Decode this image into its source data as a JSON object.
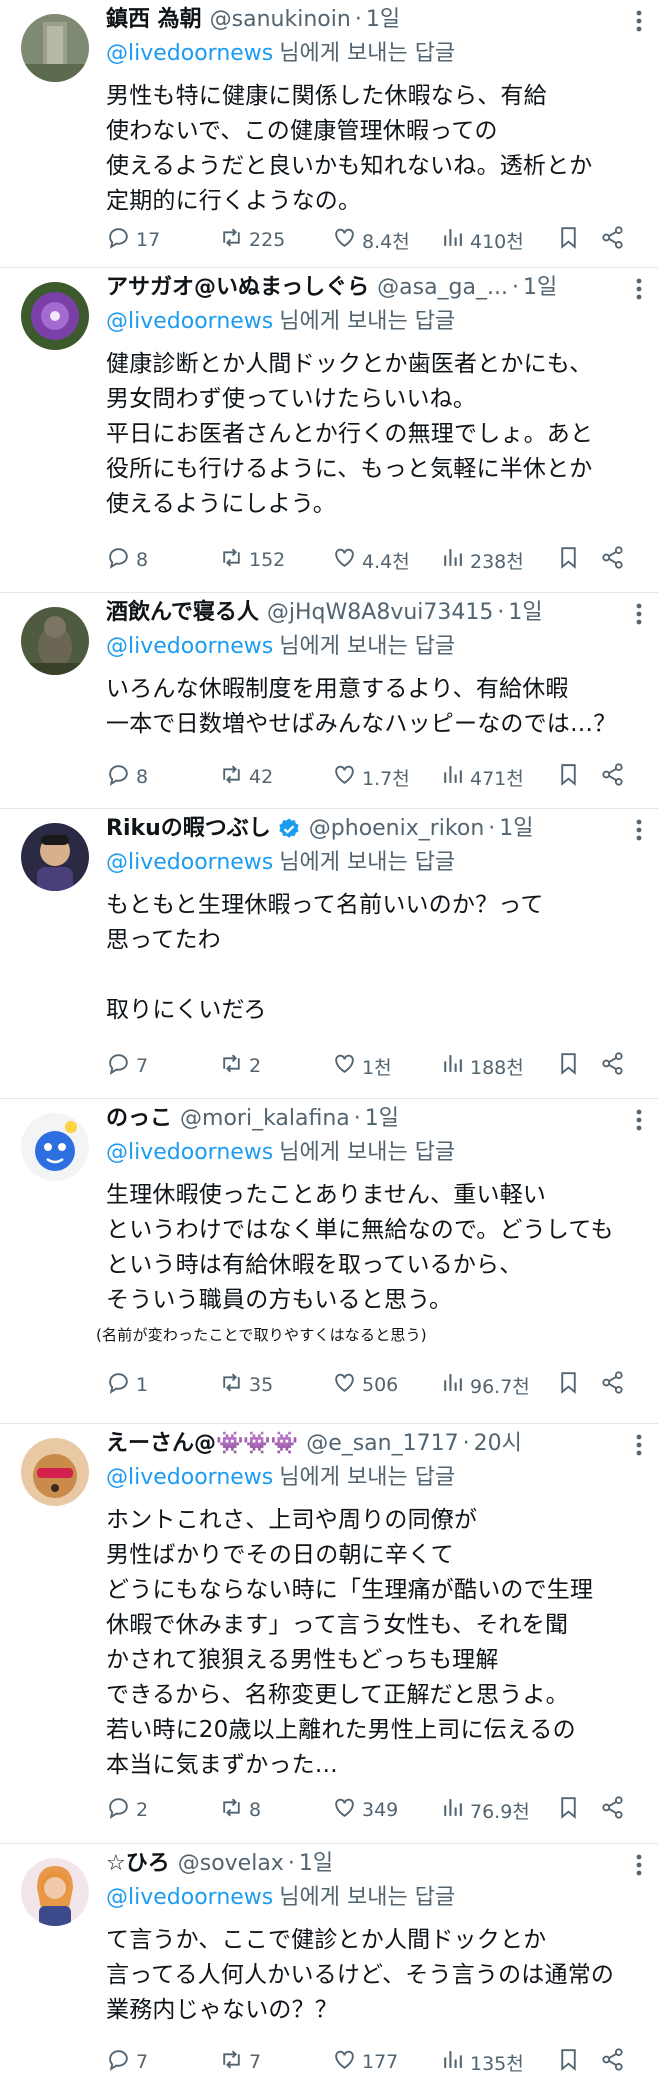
{
  "accent_color": "#1d9bf0",
  "secondary_text_color": "#536471",
  "reply_to_label": "님에게 보내는 답글",
  "tweets": [
    {
      "name": "鎮西 為朝",
      "handle": "@sanukinoin",
      "time": "1일",
      "reply_to": "@livedoornews",
      "lines": [
        "男性も特に健康に関係した休暇なら、有給",
        "使わないで、この健康管理休暇っての",
        "使えるようだと良いかも知れないね。透析とか",
        "定期的に行くようなの。"
      ],
      "replies": "17",
      "retweets": "225",
      "likes": "8.4천",
      "views": "410천"
    },
    {
      "name": "アサガオ@いぬまっしぐら",
      "handle": "@asa_ga_...",
      "time": "1일",
      "reply_to": "@livedoornews",
      "lines": [
        "健康診断とか人間ドックとか歯医者とかにも、",
        "男女問わず使っていけたらいいね。",
        "平日にお医者さんとか行くの無理でしょ。あと",
        "役所にも行けるように、もっと気軽に半休とか",
        "使えるようにしよう。"
      ],
      "replies": "8",
      "retweets": "152",
      "likes": "4.4천",
      "views": "238천"
    },
    {
      "name": "酒飲んで寝る人",
      "handle": "@jHqW8A8vui73415",
      "time": "1일",
      "reply_to": "@livedoornews",
      "lines": [
        "いろんな休暇制度を用意するより、有給休暇",
        "一本で日数増やせばみんなハッピーなのでは…？"
      ],
      "replies": "8",
      "retweets": "42",
      "likes": "1.7천",
      "views": "471천"
    },
    {
      "name": "Rikuの暇つぶし",
      "handle": "@phoenix_rikon",
      "time": "1일",
      "reply_to": "@livedoornews",
      "lines": [
        "もともと生理休暇って名前いいのか？って",
        "思ってたわ",
        "",
        "取りにくいだろ"
      ],
      "replies": "7",
      "retweets": "2",
      "likes": "1천",
      "views": "188천"
    },
    {
      "name": "のっこ",
      "handle": "@mori_kalafina",
      "time": "1일",
      "reply_to": "@livedoornews",
      "lines": [
        "生理休暇使ったことありません、重い軽い",
        "というわけではなく単に無給なので。どうしても",
        "という時は有給休暇を取っているから、",
        "そういう職員の方もいると思う。",
        "(名前が変わったことで取りやすくはなると思う)"
      ],
      "replies": "1",
      "retweets": "35",
      "likes": "506",
      "views": "96.7천"
    },
    {
      "name": "えーさん@👾👾👾",
      "handle": "@e_san_1717",
      "time": "20시",
      "reply_to": "@livedoornews",
      "lines": [
        "ホントこれさ、上司や周りの同僚が",
        "男性ばかりでその日の朝に辛くて",
        "どうにもならない時に「生理痛が酷いので生理",
        "休暇で休みます」って言う女性も、それを聞",
        "かされて狼狽える男性もどっちも理解",
        "できるから、名称変更して正解だと思うよ。",
        "若い時に20歳以上離れた男性上司に伝えるの",
        "本当に気まずかった…"
      ],
      "replies": "2",
      "retweets": "8",
      "likes": "349",
      "views": "76.9천"
    },
    {
      "name": "☆ひろ",
      "handle": "@sovelax",
      "time": "1일",
      "reply_to": "@livedoornews",
      "lines": [
        "て言うか、ここで健診とか人間ドックとか",
        "言ってる人何人かいるけど、そう言うのは通常の",
        "業務内じゃないの？？"
      ],
      "replies": "7",
      "retweets": "7",
      "likes": "177",
      "views": "135천"
    }
  ]
}
